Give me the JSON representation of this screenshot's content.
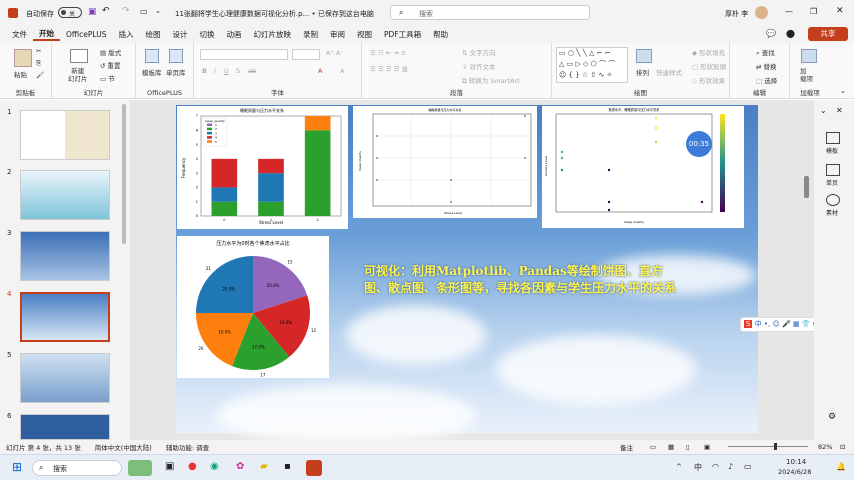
{
  "titlebar": {
    "autosave": "自动保存",
    "toggle": "关",
    "doc_title": "11张翻将学生心理健康数据可视化分析.p... • 已保存到这台电脑",
    "search_placeholder": "搜索",
    "user": "厚朴 李"
  },
  "menu": [
    "文件",
    "开始",
    "OfficePLUS",
    "插入",
    "绘图",
    "设计",
    "切换",
    "动画",
    "幻灯片放映",
    "录制",
    "审阅",
    "视图",
    "PDF工具箱",
    "帮助"
  ],
  "share_label": "共享",
  "ribbon": {
    "clipboard": {
      "paste": "粘贴",
      "label": "剪贴板"
    },
    "slides": {
      "new": "新建\n幻灯片",
      "layout": "版式",
      "reset": "重置",
      "section": "节",
      "label": "幻灯片"
    },
    "officeplus": {
      "a": "模板库",
      "b": "单页库",
      "label": "OfficePLUS"
    },
    "font": {
      "label": "字体"
    },
    "paragraph": {
      "dir": "文字方向",
      "align": "对齐文本",
      "smartart": "转换为 SmartArt",
      "label": "段落"
    },
    "drawing": {
      "arrange": "排列",
      "style": "快速样式",
      "fill": "形状填充",
      "outline": "形状轮廓",
      "effect": "形状效果",
      "label": "绘图"
    },
    "editing": {
      "find": "查找",
      "replace": "替换",
      "select": "选择",
      "label": "编辑"
    },
    "addins": {
      "btn": "加\n载项",
      "label": "加载项"
    }
  },
  "thumbnails": [
    {
      "n": "1"
    },
    {
      "n": "2"
    },
    {
      "n": "3"
    },
    {
      "n": "4"
    },
    {
      "n": "5"
    },
    {
      "n": "6"
    }
  ],
  "slide": {
    "caption": "可视化：利用Matplotlib、Pandas等绘制饼图、直方图、散点图、条形图等，寻找各因素与学生压力水平的关系",
    "timer": "00:35"
  },
  "chart_data": [
    {
      "type": "bar",
      "title": "睡眠质量与压力水平关系",
      "xlabel": "Stress Level",
      "ylabel": "Frequency",
      "categories": [
        "0",
        "1",
        "2"
      ],
      "legend_title": "sleep_quality",
      "series": [
        {
          "name": "1",
          "values": [
            0,
            0,
            0
          ]
        },
        {
          "name": "2",
          "values": [
            1,
            1,
            6
          ]
        },
        {
          "name": "3",
          "values": [
            1,
            2,
            0
          ]
        },
        {
          "name": "4",
          "values": [
            2,
            1,
            0
          ]
        },
        {
          "name": "5",
          "values": [
            0,
            0,
            1
          ]
        }
      ],
      "ylim": [
        0,
        7
      ]
    },
    {
      "type": "scatter",
      "title": "睡眠质量与压力水平关系",
      "xlabel": "Stress Level",
      "ylabel": "Sleep Quality"
    },
    {
      "type": "scatter",
      "title": "焦虑水平、睡眠质量与压力水平关系",
      "xlabel": "Sleep Quality",
      "ylabel": "Anxiety Level"
    },
    {
      "type": "pie",
      "title": "压力水平为0时各个焦虑水平占比",
      "labels": [
        "15",
        "12",
        "17",
        "20",
        "21"
      ],
      "values": [
        20,
        19,
        17,
        19,
        25
      ],
      "pcts": [
        "20.0%",
        "19.0%",
        "17.0%",
        "19.0%",
        "25.0%"
      ]
    }
  ],
  "status": {
    "slide": "幻灯片 第 4 张，共 13 张",
    "lang": "简体中文(中国大陆)",
    "access": "辅助功能: 调查",
    "notes": "备注",
    "zoom": "82%"
  },
  "taskbar": {
    "search": "搜索",
    "time": "10:14",
    "date": "2024/6/28"
  },
  "right_pane": [
    {
      "label": "模板"
    },
    {
      "label": "单页"
    },
    {
      "label": "素材"
    }
  ]
}
